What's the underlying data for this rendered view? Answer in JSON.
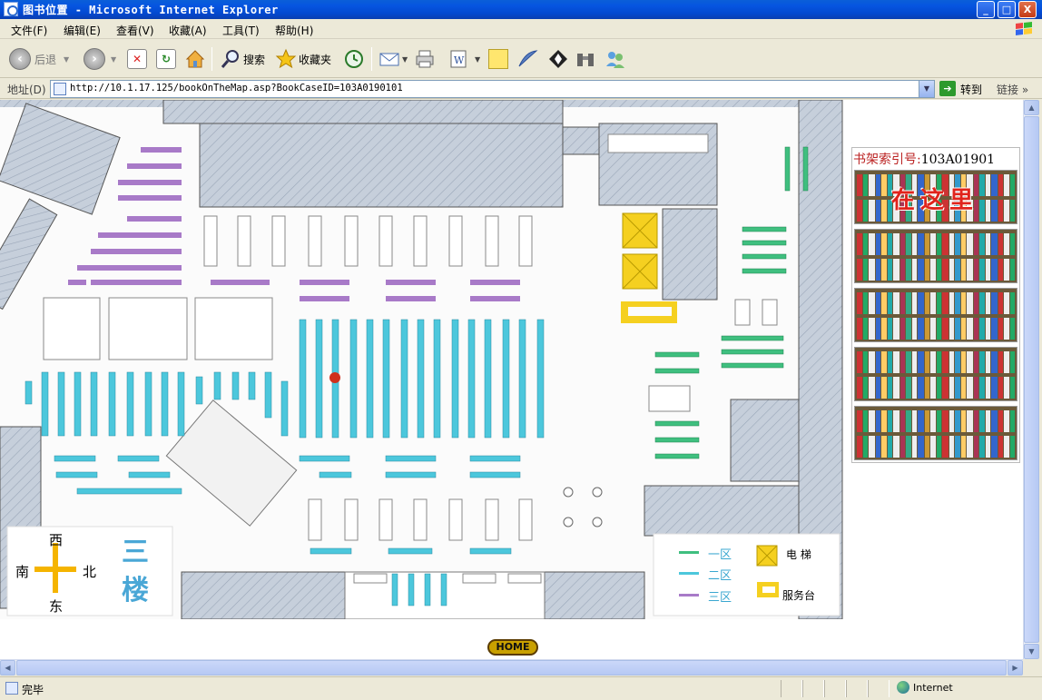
{
  "window": {
    "title": "图书位置 - Microsoft Internet Explorer",
    "minimize": "_",
    "maximize": "□",
    "close": "X"
  },
  "menu": [
    {
      "label": "文件(F)"
    },
    {
      "label": "编辑(E)"
    },
    {
      "label": "查看(V)"
    },
    {
      "label": "收藏(A)"
    },
    {
      "label": "工具(T)"
    },
    {
      "label": "帮助(H)"
    }
  ],
  "toolbar": {
    "back": "后退",
    "search": "搜索",
    "favorites": "收藏夹"
  },
  "address": {
    "label": "地址(D)",
    "url": "http://10.1.17.125/bookOnTheMap.asp?BookCaseID=103A0190101",
    "go": "转到",
    "links": "链接"
  },
  "panel": {
    "index_label": "书架索引号:",
    "index_value": "103A01901",
    "here_label": "在这里"
  },
  "compass": {
    "west": "西",
    "south": "南",
    "north": "北",
    "east": "东",
    "floor": "三楼"
  },
  "legend": {
    "zone1": "一区",
    "zone2": "二区",
    "zone3": "三区",
    "elevator": "电 梯",
    "service": "服务台",
    "colors": {
      "zone1": "#3fbf7f",
      "zone2": "#4cc7dc",
      "zone3": "#a87ac8",
      "elevator": "#f5d020",
      "wall": "#c3ccd8"
    }
  },
  "home_button": "HOME",
  "status": {
    "text": "完毕",
    "zone": "Internet"
  }
}
